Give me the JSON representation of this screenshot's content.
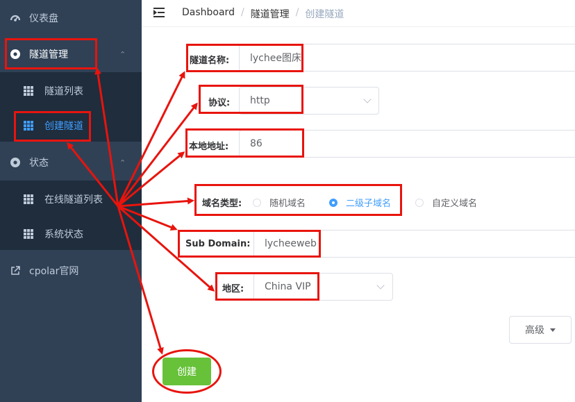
{
  "sidebar": {
    "items": [
      {
        "label": "仪表盘",
        "icon": "dashboard-icon"
      },
      {
        "label": "隧道管理",
        "icon": "tunnel-icon"
      },
      {
        "label": "隧道列表",
        "icon": "grid-icon"
      },
      {
        "label": "创建隧道",
        "icon": "grid-icon"
      },
      {
        "label": "状态",
        "icon": "status-icon"
      },
      {
        "label": "在线隧道列表",
        "icon": "grid-icon"
      },
      {
        "label": "系统状态",
        "icon": "grid-icon"
      },
      {
        "label": "cpolar官网",
        "icon": "external-link-icon"
      }
    ]
  },
  "header": {
    "breadcrumb": [
      "Dashboard",
      "隧道管理",
      "创建隧道"
    ],
    "separator": "/"
  },
  "form": {
    "name_label": "隧道名称:",
    "name_value": "lychee图床",
    "protocol_label": "协议:",
    "protocol_value": "http",
    "local_label": "本地地址:",
    "local_value": "86",
    "domain_type_label": "域名类型:",
    "domain_types": [
      "随机域名",
      "二级子域名",
      "自定义域名"
    ],
    "domain_type_selected": "二级子域名",
    "subdomain_label": "Sub Domain:",
    "subdomain_value": "lycheeweb",
    "region_label": "地区:",
    "region_value": "China VIP",
    "advanced_label": "高级",
    "create_label": "创建"
  },
  "colors": {
    "sidebar_bg": "#304156",
    "submenu_bg": "#1f2d3d",
    "active": "#409eff",
    "create_button": "#67c23a",
    "annotation": "#e8140d"
  }
}
